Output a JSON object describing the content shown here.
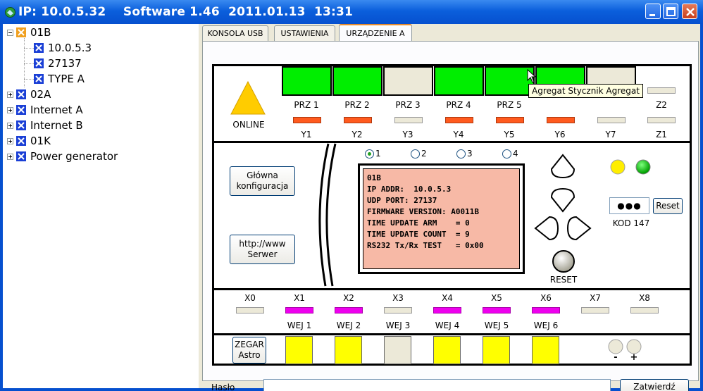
{
  "window": {
    "title": "IP: 10.0.5.32    Software 1.46  2011.01.13  13:31"
  },
  "tree": {
    "items": [
      {
        "label": "01B",
        "icon": "orange-x-icon",
        "expanded": true
      },
      {
        "label": "10.0.5.3",
        "icon": "blue-x-icon"
      },
      {
        "label": "27137",
        "icon": "blue-x-icon"
      },
      {
        "label": "TYPE A",
        "icon": "blue-x-icon"
      },
      {
        "label": "02A",
        "icon": "blue-x-icon",
        "expanded": false
      },
      {
        "label": "Internet A",
        "icon": "blue-x-icon",
        "expanded": false
      },
      {
        "label": "Internet B",
        "icon": "blue-x-icon",
        "expanded": false
      },
      {
        "label": "01K",
        "icon": "blue-x-icon",
        "expanded": false
      },
      {
        "label": "Power generator",
        "icon": "blue-x-icon",
        "expanded": false
      }
    ]
  },
  "tabs": [
    {
      "label": "KONSOLA USB"
    },
    {
      "label": "USTAWIENIA"
    },
    {
      "label": "URZĄDZENIE A",
      "active": true
    }
  ],
  "device": {
    "online_label": "ONLINE",
    "relays": [
      {
        "label": "PRZ 1",
        "state": "on"
      },
      {
        "label": "PRZ 2",
        "state": "on"
      },
      {
        "label": "PRZ 3",
        "state": "off"
      },
      {
        "label": "PRZ 4",
        "state": "on"
      },
      {
        "label": "PRZ 5",
        "state": "on"
      },
      {
        "label": "",
        "state": "on"
      },
      {
        "label": "",
        "state": "off"
      }
    ],
    "relay_colors": {
      "on": "#00ee00",
      "off": "#ece9d8"
    },
    "y_outputs": [
      {
        "label": "Y1",
        "state": "red"
      },
      {
        "label": "Y2",
        "state": "red"
      },
      {
        "label": "Y3",
        "state": "off"
      },
      {
        "label": "Y4",
        "state": "red"
      },
      {
        "label": "Y5",
        "state": "red"
      },
      {
        "label": "Y6",
        "state": "red"
      },
      {
        "label": "Y7",
        "state": "off"
      }
    ],
    "z_outputs": [
      {
        "label": "Z2",
        "state": "off"
      },
      {
        "label": "Z1",
        "state": "off"
      }
    ],
    "tooltip": "Agregat Stycznik Agregat",
    "buttons": {
      "main_config": "Główna\nkonfiguracja",
      "http_server": "http://www\nSerwer",
      "reset_small": "Reset",
      "zegar": "ZEGAR\nAstro",
      "zatwierdz": "Zatwierdź"
    },
    "radios": [
      {
        "label": "1",
        "selected": true
      },
      {
        "label": "2",
        "selected": false
      },
      {
        "label": "3",
        "selected": false
      },
      {
        "label": "4",
        "selected": false
      }
    ],
    "lcd_lines": [
      "01B",
      "IP ADDR:  10.0.5.3",
      "UDP PORT: 27137",
      "FIRMWARE VERSION: A0011B",
      "TIME UPDATE ARM    = 0",
      "TIME UPDATE COUNT  = 9",
      "RS232 Tx/Rx TEST   = 0x00"
    ],
    "reset_label": "RESET",
    "code_display": "●●●",
    "code_label": "KOD 147",
    "indicators": {
      "yellow": "#ffee00",
      "green": "#00cc00"
    },
    "x_inputs": [
      {
        "label": "X0",
        "state": "off"
      },
      {
        "label": "X1",
        "state": "mag"
      },
      {
        "label": "X2",
        "state": "mag"
      },
      {
        "label": "X3",
        "state": "off"
      },
      {
        "label": "X4",
        "state": "mag"
      },
      {
        "label": "X5",
        "state": "mag"
      },
      {
        "label": "X6",
        "state": "mag"
      },
      {
        "label": "X7",
        "state": "off"
      },
      {
        "label": "X8",
        "state": "off"
      }
    ],
    "wej_labels": [
      "WEJ 1",
      "WEJ 2",
      "WEJ 3",
      "WEJ 4",
      "WEJ 5",
      "WEJ 6"
    ],
    "input_boxes": [
      {
        "state": "yellow"
      },
      {
        "state": "yellow"
      },
      {
        "state": "off"
      },
      {
        "state": "yellow"
      },
      {
        "state": "yellow"
      },
      {
        "state": "yellow"
      }
    ],
    "input_colors": {
      "yellow": "#ffff00",
      "off": "#ece9d8"
    },
    "minus_label": "-",
    "plus_label": "+"
  },
  "password": {
    "label": "Hasło",
    "value": ""
  }
}
